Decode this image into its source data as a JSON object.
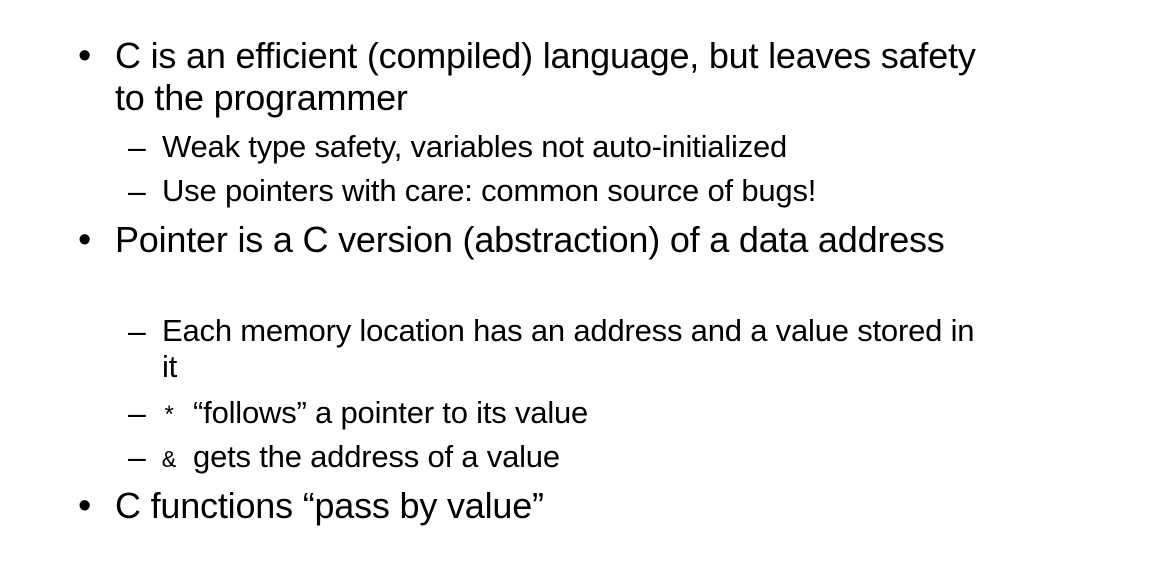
{
  "slide": {
    "bullets": [
      {
        "text": "C is an efficient (compiled) language, but leaves safety to the programmer",
        "subs": [
          "Weak type safety, variables not auto-initialized",
          "Use pointers with care: common source of bugs!"
        ]
      },
      {
        "text": "Pointer is a C version (abstraction) of a data address",
        "subs": [
          "Each memory location has an address and a value stored in it",
          {
            "code": "*",
            "text": "“follows” a pointer to its value"
          },
          {
            "code": "&",
            "text": "gets the address of a value"
          }
        ]
      },
      {
        "text": "C functions “pass by value”",
        "subs": []
      }
    ],
    "bullet_glyph": "•",
    "dash_glyph": "–"
  }
}
